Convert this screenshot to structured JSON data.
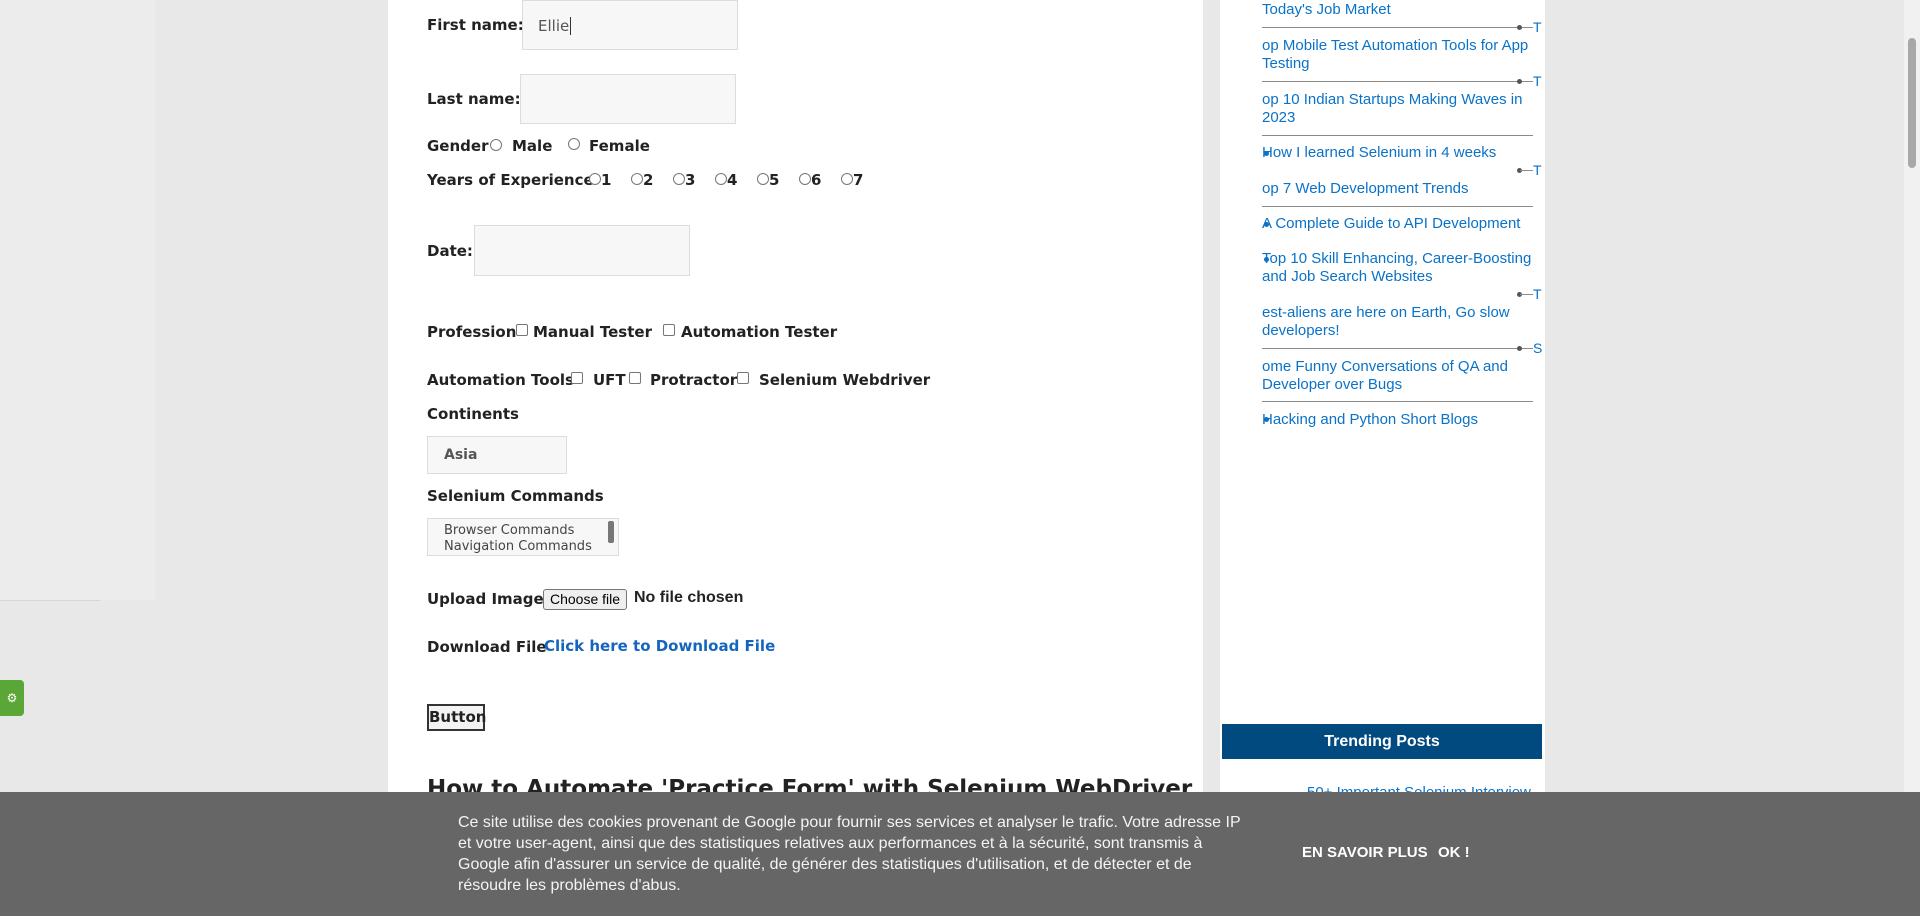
{
  "form": {
    "first_name_label": "First name:",
    "first_name_value": "Ellie",
    "last_name_label": "Last name:",
    "last_name_value": "",
    "gender_label": "Gender",
    "gender_options": [
      "Male",
      "Female"
    ],
    "experience_label": "Years of Experience",
    "experience_options": [
      "1",
      "2",
      "3",
      "4",
      "5",
      "6",
      "7"
    ],
    "date_label": "Date:",
    "date_value": "",
    "profession_label": "Profession",
    "profession_options": [
      "Manual Tester",
      "Automation Tester"
    ],
    "tools_label": "Automation Tools",
    "tools_options": [
      "UFT",
      "Protractor",
      "Selenium Webdriver"
    ],
    "continents_label": "Continents",
    "continents_selected": "Asia",
    "commands_label": "Selenium Commands",
    "commands_options": [
      "Browser Commands",
      "Navigation Commands"
    ],
    "upload_label": "Upload Image",
    "upload_button": "Choose file",
    "upload_status": "No file chosen",
    "download_label": "Download File",
    "download_link": "Click here to Download File",
    "button_label": "Button",
    "post_heading": "How to Automate 'Practice Form' with Selenium WebDriver"
  },
  "sidebar": {
    "links": [
      "Today's Job Market",
      "op Mobile Test Automation Tools for App Testing",
      "op 10 Indian Startups Making Waves in 2023",
      "How I learned Selenium in 4 weeks",
      "op 7 Web Development Trends",
      "A Complete Guide to API Development",
      "Top 10 Skill Enhancing, Career-Boosting and Job Search Websites",
      "est-aliens are here on Earth, Go slow developers!",
      "ome Funny Conversations of QA and Developer over Bugs",
      "Hacking and Python Short Blogs"
    ],
    "edge_letters": [
      "T",
      "T",
      "T",
      "T",
      "S"
    ],
    "trending_title": "Trending Posts",
    "trending_first": "50+ Important Selenium Interview"
  },
  "cookie": {
    "text": "Ce site utilise des cookies provenant de Google pour fournir ses services et analyser le trafic. Votre adresse IP et votre user-agent, ainsi que des statistiques relatives aux performances et à la sécurité, sont transmis à Google afin d'assurer un service de qualité, de générer des statistiques d'utilisation, et de détecter et de résoudre les problèmes d'abus.",
    "learn_more": "EN SAVOIR PLUS",
    "ok": "OK !"
  },
  "colors": {
    "link": "#0a72c7",
    "trending_bg": "#004a7f",
    "cookie_bg": "#666666",
    "settings_green": "#5aa637"
  },
  "icons": [
    "gear-icon"
  ]
}
